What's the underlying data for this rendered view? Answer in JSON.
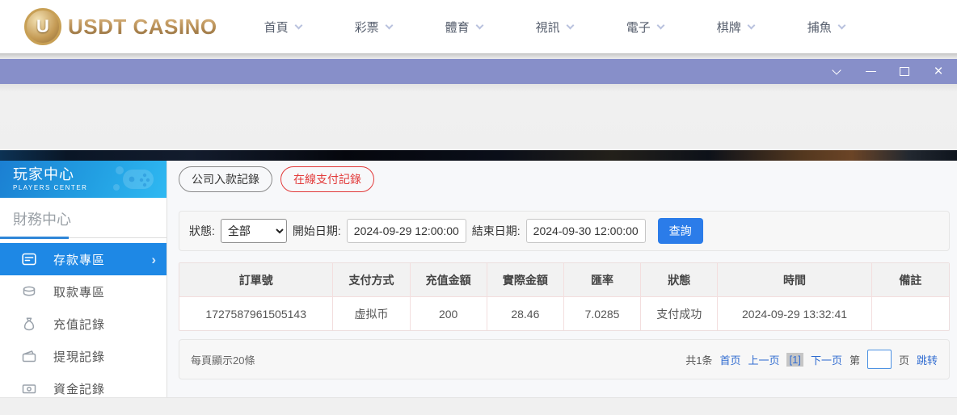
{
  "header": {
    "logo_badge": "U",
    "logo_text": "USDT CASINO",
    "nav": [
      {
        "label": "首頁"
      },
      {
        "label": "彩票"
      },
      {
        "label": "體育"
      },
      {
        "label": "視訊"
      },
      {
        "label": "電子"
      },
      {
        "label": "棋牌"
      },
      {
        "label": "捕魚"
      }
    ]
  },
  "sidebar": {
    "title": "玩家中心",
    "subtitle": "PLAYERS CENTER",
    "section": "財務中心",
    "items": [
      {
        "label": "存款專區",
        "icon": "deposit-icon",
        "active": true
      },
      {
        "label": "取款專區",
        "icon": "withdraw-icon",
        "active": false
      },
      {
        "label": "充值記錄",
        "icon": "recharge-record-icon",
        "active": false
      },
      {
        "label": "提現記錄",
        "icon": "withdrawal-record-icon",
        "active": false
      },
      {
        "label": "資金記錄",
        "icon": "funds-record-icon",
        "active": false
      }
    ]
  },
  "main": {
    "tabs": [
      {
        "label": "公司入款記錄",
        "active": false
      },
      {
        "label": "在線支付記錄",
        "active": true
      }
    ],
    "filters": {
      "status_label": "狀態:",
      "status_value": "全部",
      "start_label": "開始日期:",
      "start_value": "2024-09-29 12:00:00",
      "end_label": "結束日期:",
      "end_value": "2024-09-30 12:00:00",
      "search_button": "查詢"
    },
    "table": {
      "headers": [
        "訂單號",
        "支付方式",
        "充值金額",
        "實際金額",
        "匯率",
        "狀態",
        "時間",
        "備註"
      ],
      "rows": [
        [
          "1727587961505143",
          "虚拟币",
          "200",
          "28.46",
          "7.0285",
          "支付成功",
          "2024-09-29 13:32:41",
          ""
        ]
      ]
    },
    "pagination": {
      "page_size_text": "每頁顯示20條",
      "total_text": "共1条",
      "first_label": "首页",
      "prev_label": "上一页",
      "current_label": "[1]",
      "next_label": "下一页",
      "jump_prefix": "第",
      "jump_value": "",
      "jump_suffix": "页",
      "jump_action": "跳转"
    }
  },
  "colors": {
    "brand_gold": "#b38a52",
    "titlebar_purple": "#878fc9",
    "sidebar_blue": "#1e88e5",
    "accent_blue": "#2b7ce9",
    "link_blue": "#2f6bd0",
    "tab_red": "#e23a3a"
  }
}
